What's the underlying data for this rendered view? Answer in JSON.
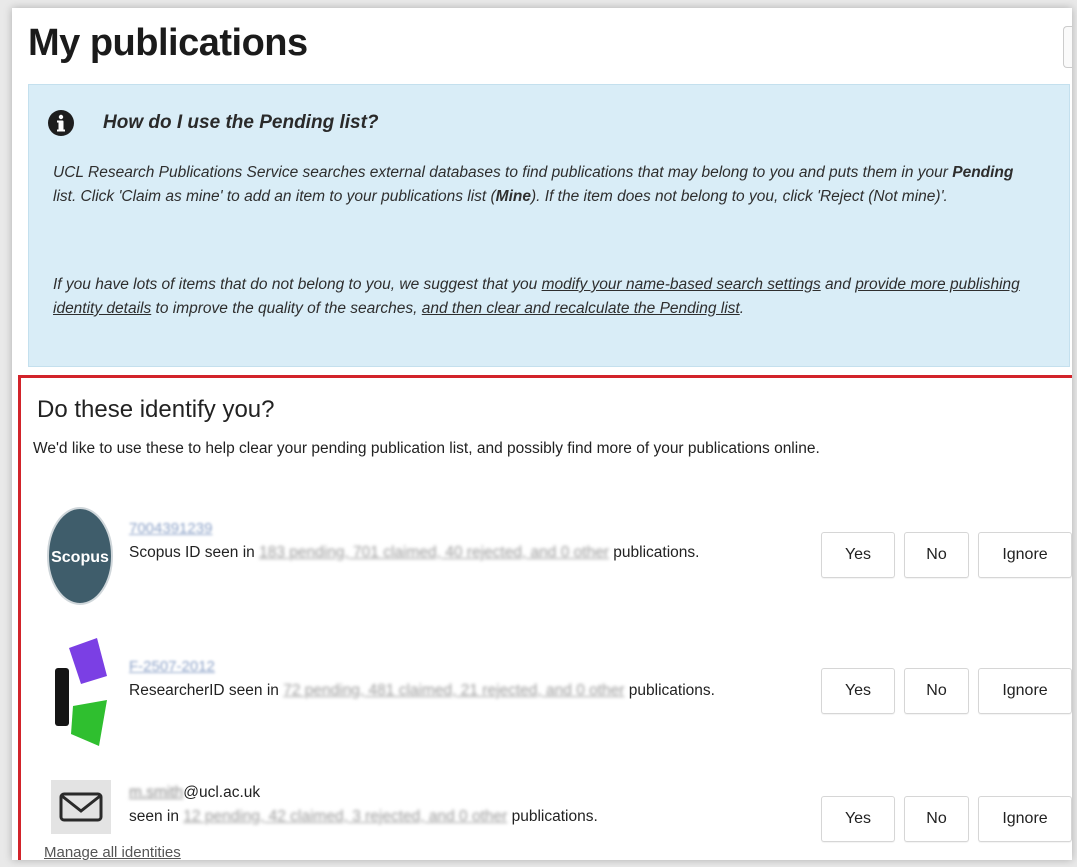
{
  "page": {
    "title": "My publications"
  },
  "info": {
    "heading": "How do I use the Pending list?",
    "p1_a": "UCL Research Publications Service searches external databases to find publications that may belong to you and puts them in your ",
    "p1_bold1": "Pending",
    "p1_b": " list. Click 'Claim as mine' to add an item to your publications list (",
    "p1_bold2": "Mine",
    "p1_c": "). If the item does not belong to you, click 'Reject (Not mine)'.",
    "p2_a": "If you have lots of items that do not belong to you, we suggest that you ",
    "p2_link1": "modify your name-based search settings",
    "p2_b": " and ",
    "p2_link2": "provide more publishing identity details",
    "p2_c": " to improve the quality of the searches, ",
    "p2_link3": "and then clear and recalculate the Pending list",
    "p2_d": "."
  },
  "identities": {
    "heading": "Do these identify you?",
    "description": "We'd like to use these to help clear your pending publication list, and possibly find more of your publications online.",
    "buttons": {
      "yes": "Yes",
      "no": "No",
      "ignore": "Ignore"
    },
    "rows": [
      {
        "icon": "scopus-logo",
        "logo_text": "Scopus",
        "id_value": "7004391239",
        "seen_prefix": "Scopus ID seen in ",
        "seen_counts": "183 pending, 701 claimed, 40 rejected, and 0 other",
        "seen_suffix": " publications."
      },
      {
        "icon": "researcherid-logo",
        "id_value": "F-2507-2012",
        "seen_prefix": "ResearcherID seen in ",
        "seen_counts": "72 pending, 481 claimed, 21 rejected, and 0 other",
        "seen_suffix": " publications."
      },
      {
        "icon": "mail-icon",
        "id_value": "m.smith",
        "email_domain": "@ucl.ac.uk",
        "seen_prefix": "seen in ",
        "seen_counts": "12 pending, 42 claimed, 3 rejected, and 0 other",
        "seen_suffix": " publications."
      }
    ],
    "manage_link": "Manage all identities"
  },
  "colors": {
    "info_bg": "#d9edf7",
    "highlight_border": "#d2232a",
    "scopus_logo": "#3f5d6b",
    "researcherid_purple": "#7b3fe4",
    "researcherid_green": "#2fbf2f"
  }
}
